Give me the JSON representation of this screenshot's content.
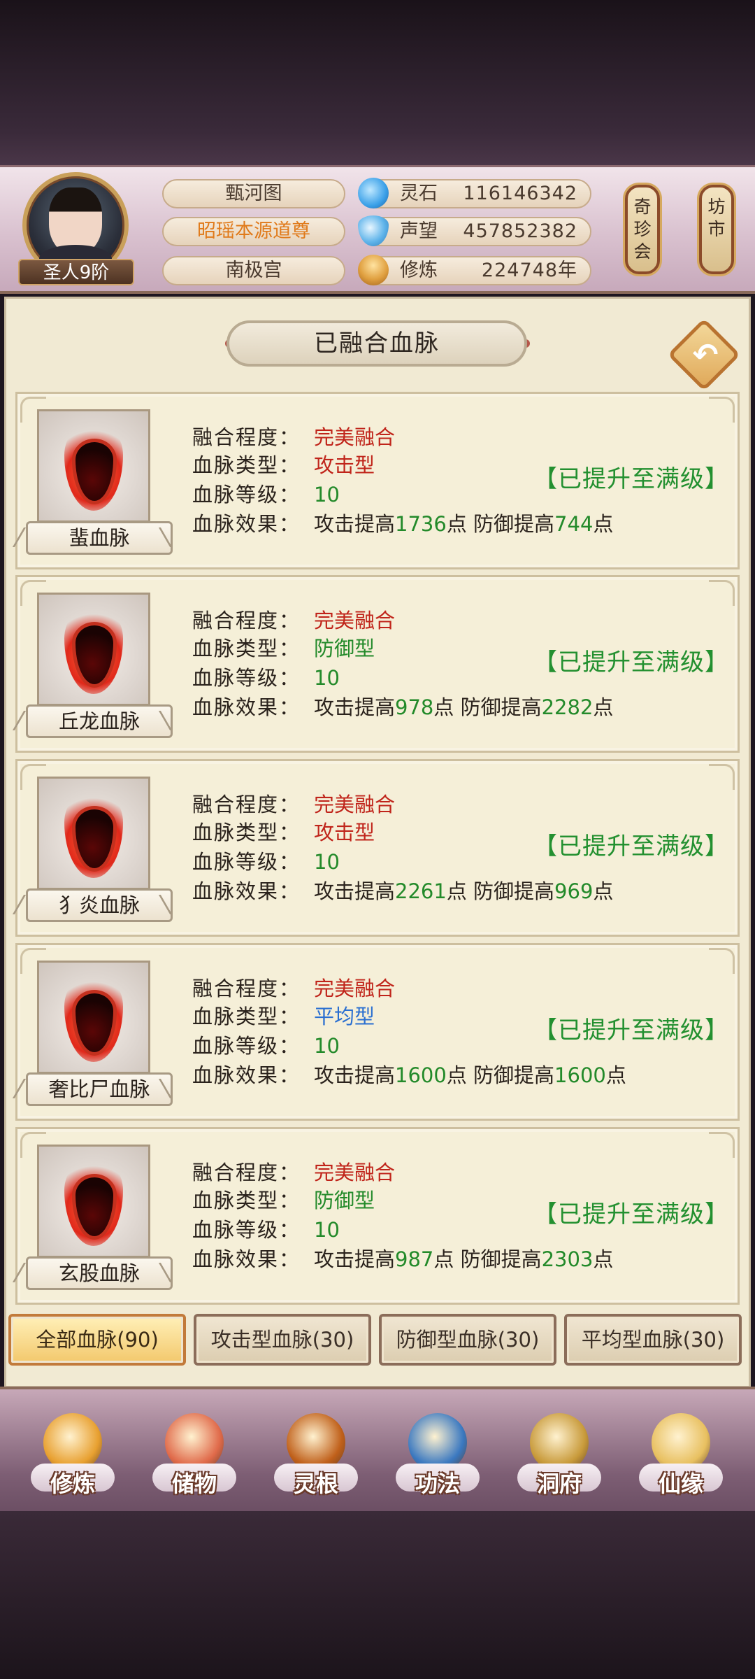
{
  "player": {
    "rank": "圣人9阶",
    "titles": [
      "甄河图",
      "昭瑶本源道尊",
      "南极宫"
    ],
    "title_colors": [
      "#4a3a2e",
      "#e07a1a",
      "#4a3a2e"
    ]
  },
  "resources": [
    {
      "label": "灵石",
      "value": "116146342",
      "icon": "spirit-stone-icon",
      "color": "#3aa0e8"
    },
    {
      "label": "声望",
      "value": "457852382",
      "icon": "prestige-crystal-icon",
      "color": "#5fb4ea"
    },
    {
      "label": "修炼",
      "value": "224748年",
      "icon": "meditation-icon",
      "color": "#e0a040"
    }
  ],
  "side_buttons": [
    {
      "label": "奇珍会"
    },
    {
      "label": "坊市"
    }
  ],
  "panel": {
    "title": "已融合血脉",
    "back_icon": "back-arrow-icon"
  },
  "field_labels": {
    "fusion": "融合程度：",
    "type": "血脉类型：",
    "level": "血脉等级：",
    "effect": "血脉效果："
  },
  "bloodlines": [
    {
      "name": "蜚血脉",
      "fusion": "完美融合",
      "type": "攻击型",
      "type_color": "#c0241a",
      "level": "10",
      "effect": [
        {
          "t": "攻击提高",
          "c": ""
        },
        {
          "t": "1736",
          "c": "green"
        },
        {
          "t": "点 防御提高",
          "c": ""
        },
        {
          "t": "744",
          "c": "green"
        },
        {
          "t": "点",
          "c": ""
        }
      ],
      "status": "【已提升至满级】"
    },
    {
      "name": "丘龙血脉",
      "fusion": "完美融合",
      "type": "防御型",
      "type_color": "#238a2a",
      "level": "10",
      "effect": [
        {
          "t": "攻击提高",
          "c": ""
        },
        {
          "t": "978",
          "c": "green"
        },
        {
          "t": "点 防御提高",
          "c": ""
        },
        {
          "t": "2282",
          "c": "green"
        },
        {
          "t": "点",
          "c": ""
        }
      ],
      "status": "【已提升至满级】"
    },
    {
      "name": "犭炎血脉",
      "fusion": "完美融合",
      "type": "攻击型",
      "type_color": "#c0241a",
      "level": "10",
      "effect": [
        {
          "t": "攻击提高",
          "c": ""
        },
        {
          "t": "2261",
          "c": "green"
        },
        {
          "t": "点 防御提高",
          "c": ""
        },
        {
          "t": "969",
          "c": "green"
        },
        {
          "t": "点",
          "c": ""
        }
      ],
      "status": "【已提升至满级】"
    },
    {
      "name": "奢比尸血脉",
      "fusion": "完美融合",
      "type": "平均型",
      "type_color": "#2a6fd1",
      "level": "10",
      "effect": [
        {
          "t": "攻击提高",
          "c": ""
        },
        {
          "t": "1600",
          "c": "green"
        },
        {
          "t": "点 防御提高",
          "c": ""
        },
        {
          "t": "1600",
          "c": "green"
        },
        {
          "t": "点",
          "c": ""
        }
      ],
      "status": "【已提升至满级】"
    },
    {
      "name": "玄股血脉",
      "fusion": "完美融合",
      "type": "防御型",
      "type_color": "#238a2a",
      "level": "10",
      "effect": [
        {
          "t": "攻击提高",
          "c": ""
        },
        {
          "t": "987",
          "c": "green"
        },
        {
          "t": "点 防御提高",
          "c": ""
        },
        {
          "t": "2303",
          "c": "green"
        },
        {
          "t": "点",
          "c": ""
        }
      ],
      "status": "【已提升至满级】"
    }
  ],
  "filters": [
    {
      "label": "全部血脉(90)",
      "active": true
    },
    {
      "label": "攻击型血脉(30)",
      "active": false
    },
    {
      "label": "防御型血脉(30)",
      "active": false
    },
    {
      "label": "平均型血脉(30)",
      "active": false
    }
  ],
  "nav": [
    {
      "label": "修炼",
      "icon": "cultivation-icon",
      "color": "#e8a030"
    },
    {
      "label": "储物",
      "icon": "storage-bag-icon",
      "color": "#e06a4a"
    },
    {
      "label": "灵根",
      "icon": "spirit-root-icon",
      "color": "#c0601a"
    },
    {
      "label": "功法",
      "icon": "technique-book-icon",
      "color": "#3a78c0"
    },
    {
      "label": "洞府",
      "icon": "cave-dwelling-icon",
      "color": "#c89a3a"
    },
    {
      "label": "仙缘",
      "icon": "immortal-fate-icon",
      "color": "#e8c060"
    }
  ]
}
